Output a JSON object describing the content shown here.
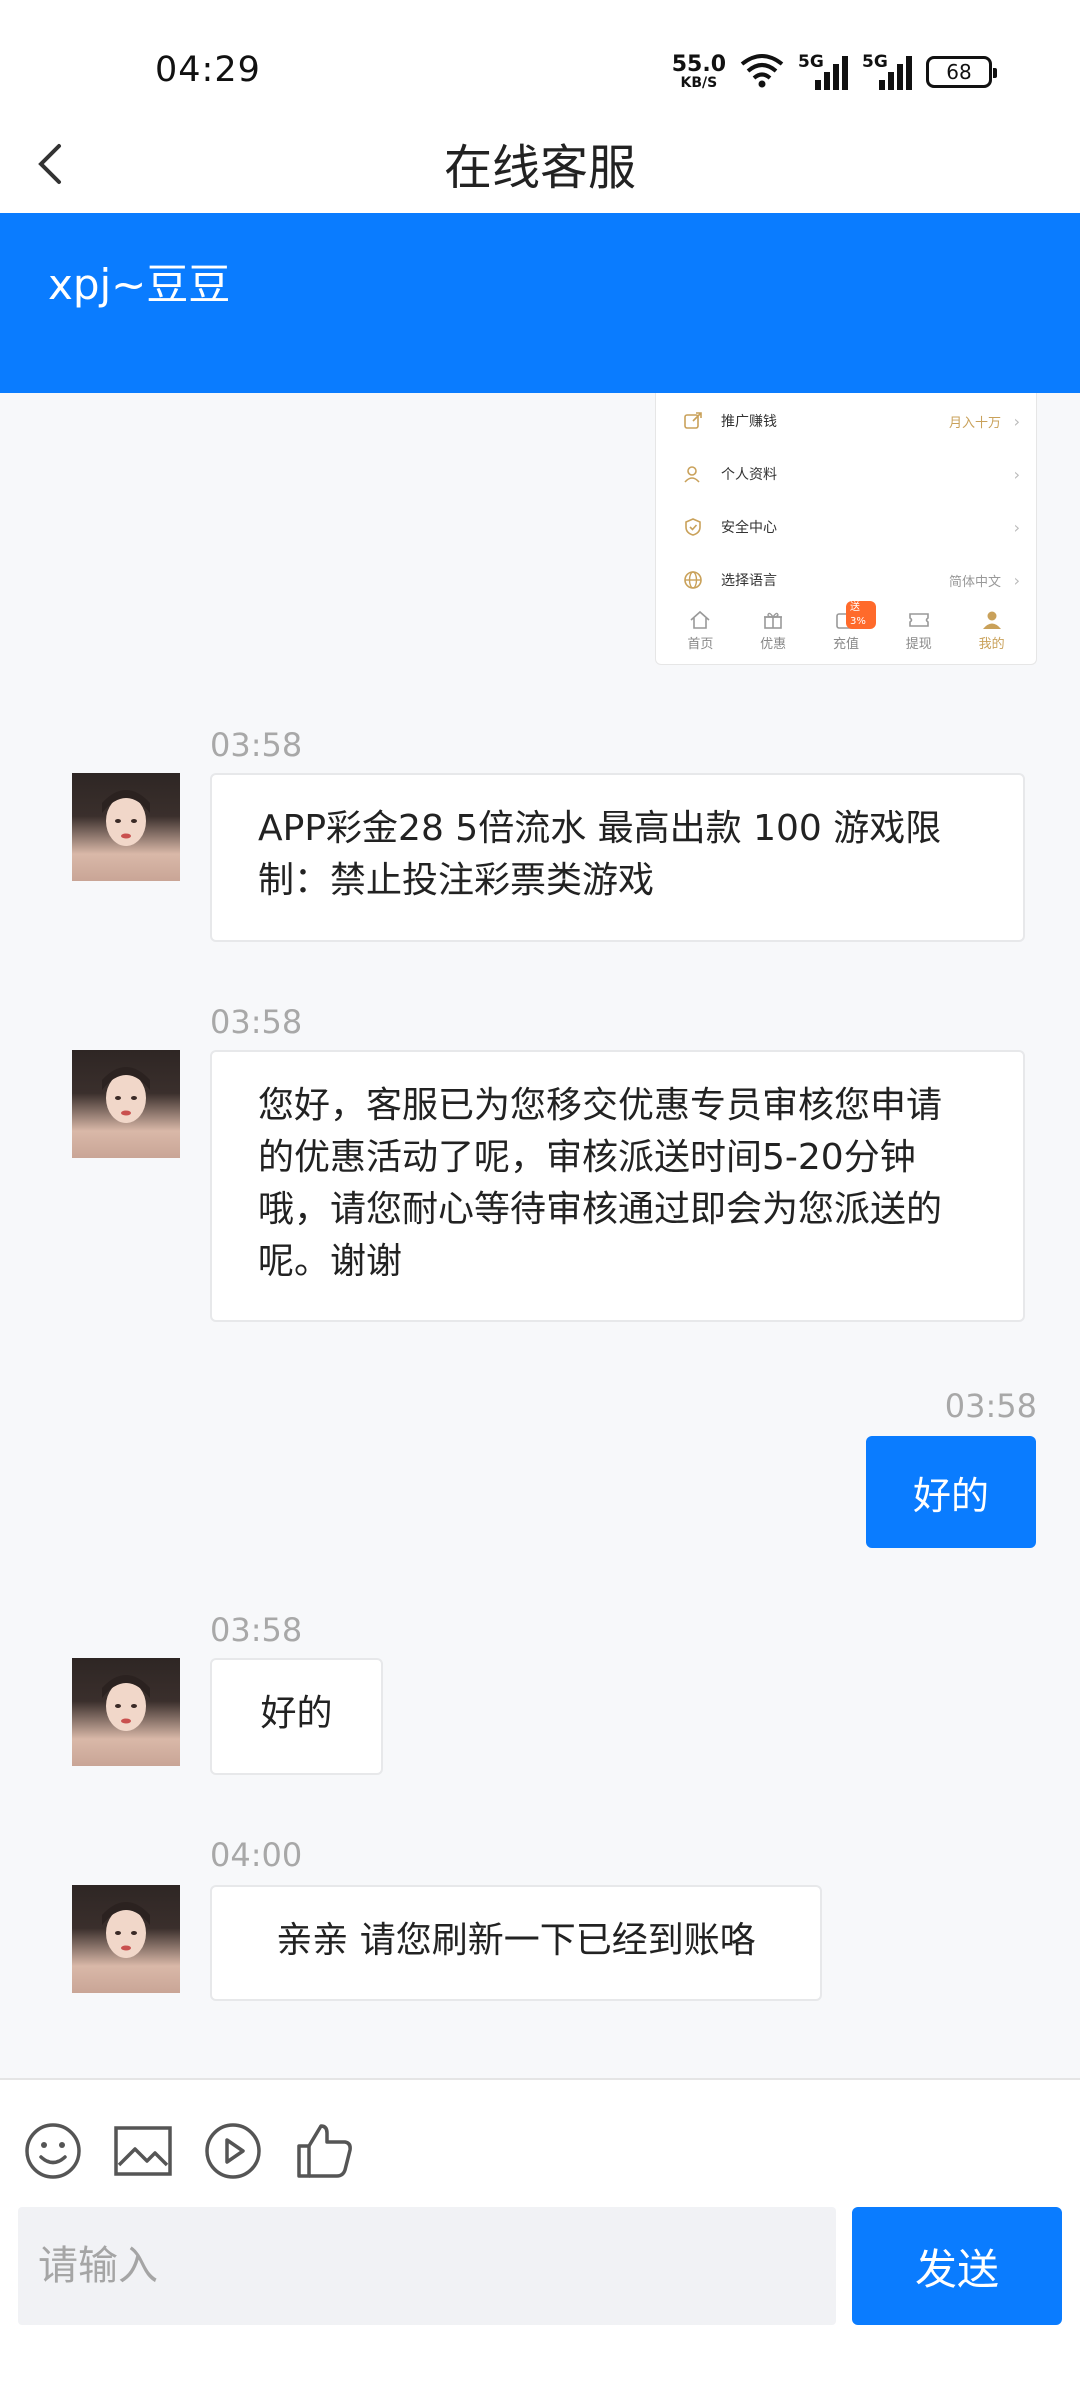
{
  "status_bar": {
    "time": "04:29",
    "net_speed_value": "55.0",
    "net_speed_unit": "KB/S",
    "sim1_label": "5G",
    "sim2_label": "5G",
    "battery": "68"
  },
  "header": {
    "title": "在线客服"
  },
  "agent": {
    "name": "xpj~豆豆"
  },
  "screenshot": {
    "rows": [
      {
        "label": "推广赚钱",
        "value": "月入十万"
      },
      {
        "label": "个人资料",
        "value": ""
      },
      {
        "label": "安全中心",
        "value": ""
      },
      {
        "label": "选择语言",
        "value": "简体中文"
      }
    ],
    "tabs": [
      {
        "label": "首页"
      },
      {
        "label": "优惠"
      },
      {
        "label": "充值",
        "badge": "送3%"
      },
      {
        "label": "提现"
      },
      {
        "label": "我的"
      }
    ]
  },
  "messages": [
    {
      "sender": "agent",
      "time": "03:58",
      "text": "APP彩金28 5倍流水 最高出款 100 游戏限制：禁止投注彩票类游戏"
    },
    {
      "sender": "agent",
      "time": "03:58",
      "text": "您好，客服已为您移交优惠专员审核您申请的优惠活动了呢，审核派送时间5-20分钟哦，请您耐心等待审核通过即会为您派送的呢。谢谢"
    },
    {
      "sender": "user",
      "time": "03:58",
      "text": "好的"
    },
    {
      "sender": "agent",
      "time": "03:58",
      "text": "好的"
    },
    {
      "sender": "agent",
      "time": "04:00",
      "text": "亲亲 请您刷新一下已经到账咯"
    }
  ],
  "composer": {
    "placeholder": "请输入",
    "send_label": "发送",
    "tools": [
      "emoji-icon",
      "image-icon",
      "video-icon",
      "thumbs-up-icon"
    ]
  },
  "colors": {
    "accent": "#0a7cff",
    "gold": "#c9a15a"
  }
}
